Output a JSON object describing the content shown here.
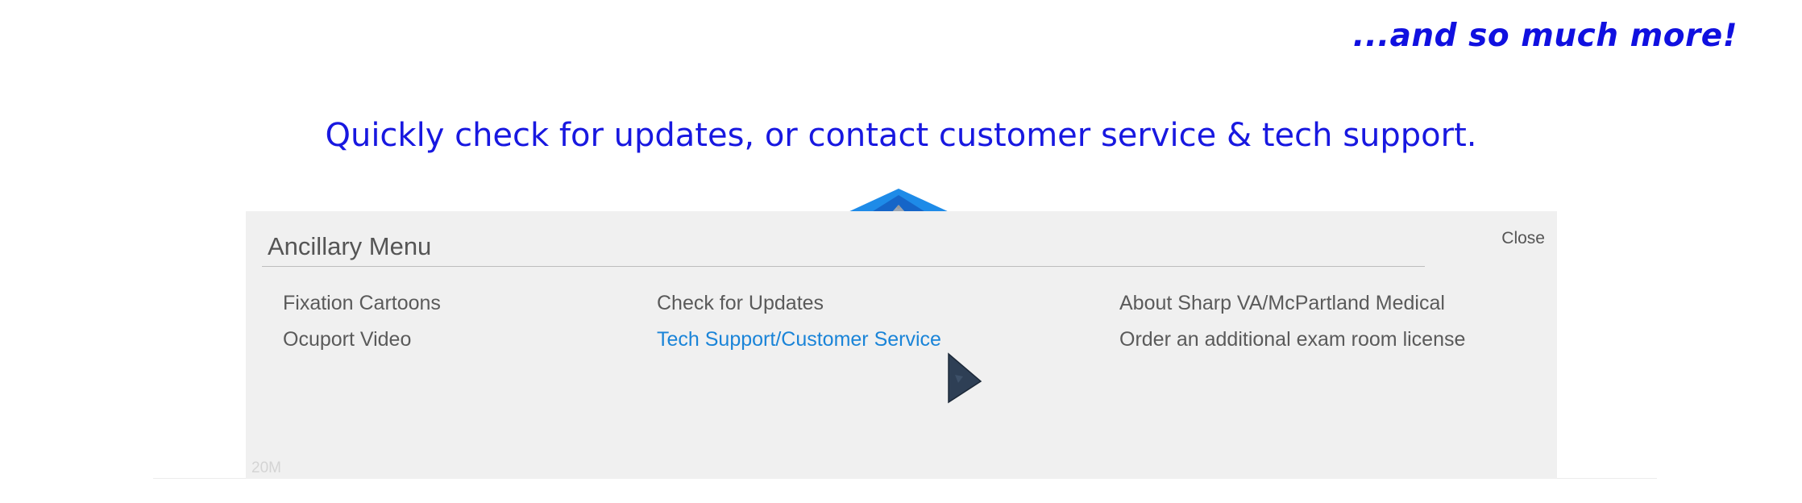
{
  "tagline": "...and so much more!",
  "headline": "Quickly check for updates, or contact customer service & tech support.",
  "ancillary_menu": {
    "title": "Ancillary Menu",
    "close_label": "Close",
    "columns": [
      [
        "Fixation Cartoons",
        "Ocuport Video"
      ],
      [
        "Check for Updates",
        "Tech Support/Customer Service"
      ],
      [
        "About Sharp VA/McPartland Medical",
        "Order an additional exam room license"
      ]
    ],
    "active_item": "Tech Support/Customer Service",
    "size_label": "20M"
  },
  "colors": {
    "headline_blue": "#1818e0",
    "panel_background": "#f0f0f0",
    "active_link": "#1a84d8",
    "tab_blue": "#1e8be8"
  },
  "icons": {
    "pointer_tab": "blue-triangle-tab-icon",
    "cursor": "mouse-pointer-icon"
  }
}
